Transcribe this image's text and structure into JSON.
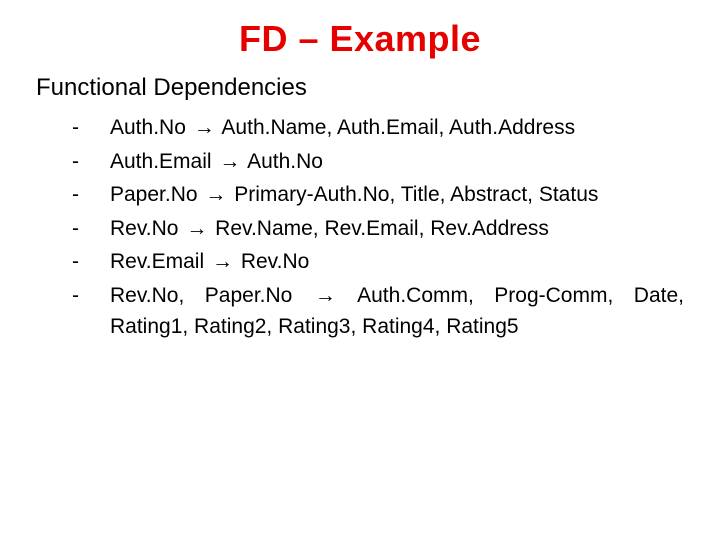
{
  "title": "FD – Example",
  "subtitle": "Functional Dependencies",
  "arrow": "→",
  "items": [
    {
      "lhs": "Auth.No",
      "rhs": "Auth.Name, Auth.Email, Auth.Address"
    },
    {
      "lhs": "Auth.Email",
      "rhs": "Auth.No"
    },
    {
      "lhs": "Paper.No",
      "rhs": "Primary-Auth.No, Title, Abstract, Status"
    },
    {
      "lhs": "Rev.No",
      "rhs": "Rev.Name, Rev.Email, Rev.Address"
    },
    {
      "lhs": "Rev.Email",
      "rhs": "Rev.No"
    },
    {
      "lhs": "Rev.No, Paper.No",
      "rhs": "Auth.Comm, Prog-Comm, Date, Rating1, Rating2, Rating3, Rating4, Rating5"
    }
  ]
}
